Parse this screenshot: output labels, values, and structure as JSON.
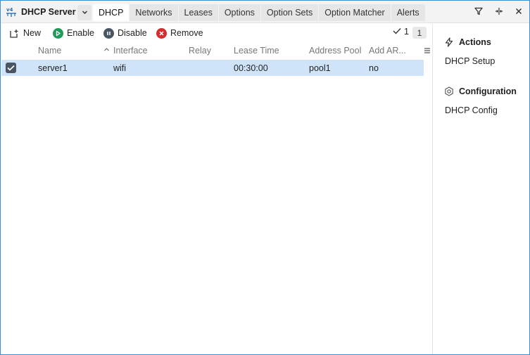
{
  "window": {
    "title": "DHCP Server",
    "tabs": [
      {
        "label": "DHCP",
        "active": true
      },
      {
        "label": "Networks"
      },
      {
        "label": "Leases"
      },
      {
        "label": "Options"
      },
      {
        "label": "Option Sets"
      },
      {
        "label": "Option Matcher"
      },
      {
        "label": "Alerts"
      }
    ],
    "controls": [
      "filter-icon",
      "collapse-icon",
      "close-icon"
    ]
  },
  "toolbar": {
    "new_label": "New",
    "enable_label": "Enable",
    "disable_label": "Disable",
    "remove_label": "Remove",
    "selected_count": "1",
    "total_count": "1"
  },
  "table": {
    "columns": [
      "Name",
      "Interface",
      "Relay",
      "Lease Time",
      "Address Pool",
      "Add AR..."
    ],
    "sort_column": "Interface",
    "rows": [
      {
        "checked": true,
        "name": "server1",
        "interface": "wifi",
        "relay": "",
        "lease_time": "00:30:00",
        "address_pool": "pool1",
        "add_arp": "no"
      }
    ]
  },
  "side": {
    "actions_title": "Actions",
    "actions_link": "DHCP Setup",
    "config_title": "Configuration",
    "config_link": "DHCP Config"
  },
  "colors": {
    "accent": "#3d8fd1",
    "enable": "#1f9a5b",
    "disable": "#4a5563",
    "remove": "#d42d2d",
    "selection": "#cfe4f8"
  }
}
